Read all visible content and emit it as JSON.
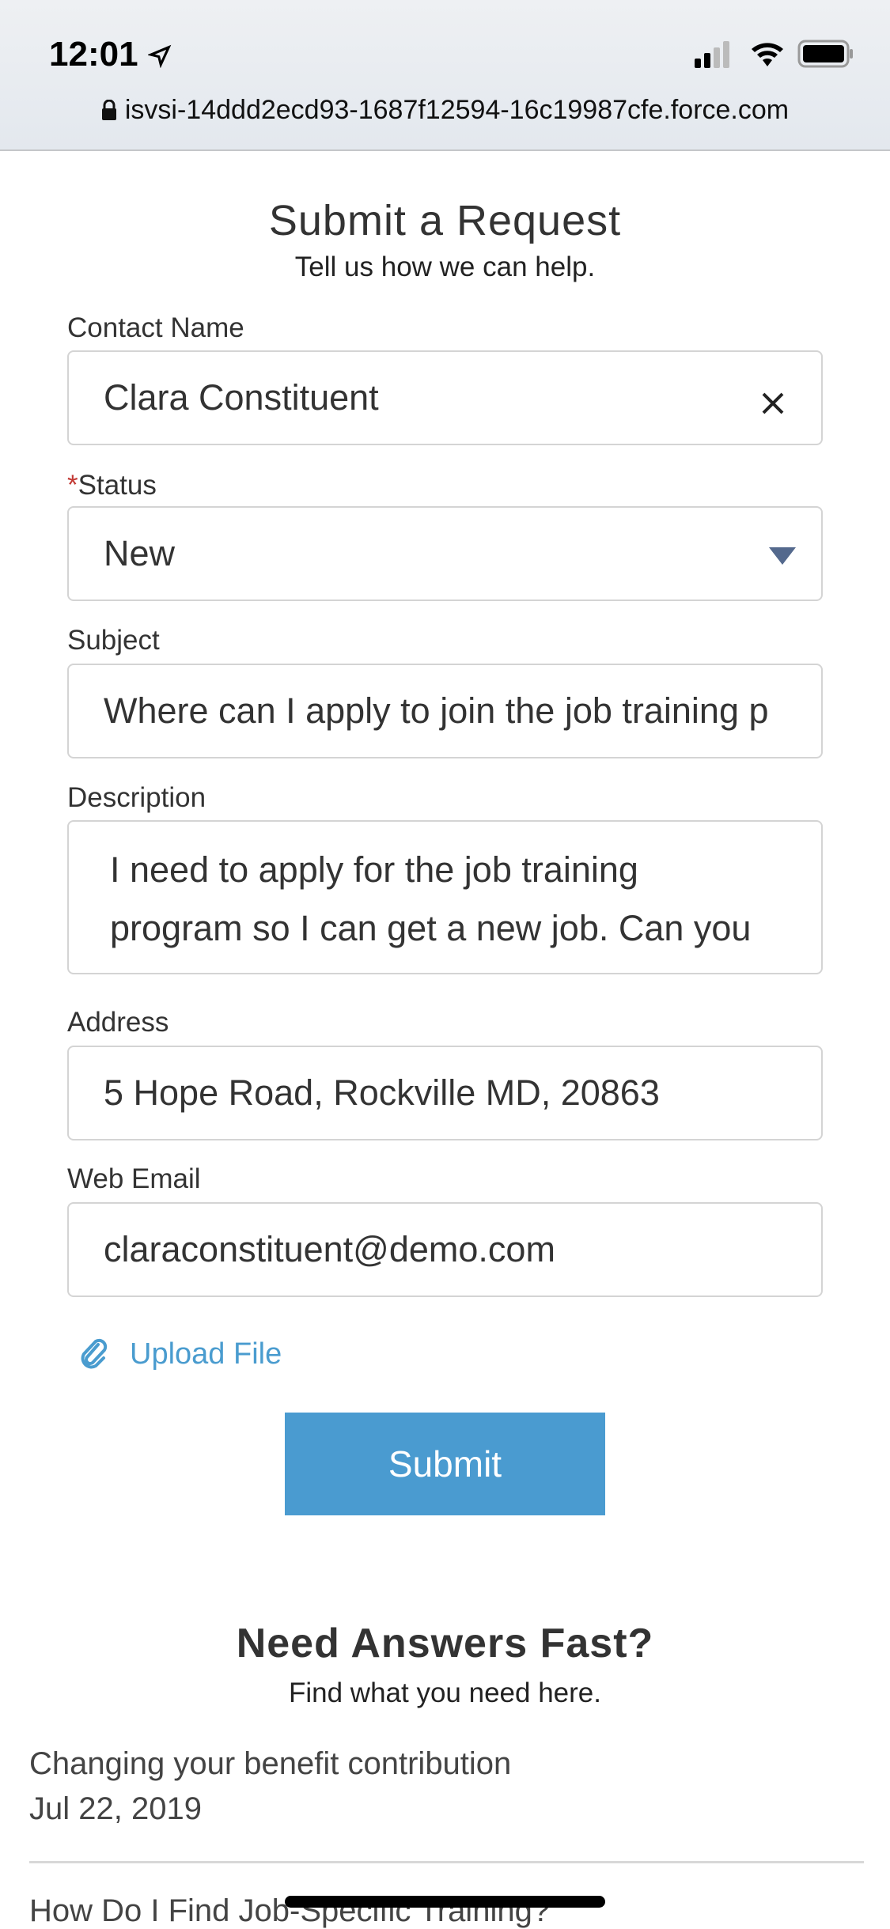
{
  "status_bar": {
    "time": "12:01",
    "icons": [
      "location-arrow-icon",
      "signal-icon",
      "wifi-icon",
      "battery-icon"
    ]
  },
  "browser": {
    "url": "isvsi-14ddd2ecd93-1687f12594-16c19987cfe.force.com"
  },
  "form": {
    "title": "Submit a Request",
    "subtitle": "Tell us how we can help.",
    "contact_name": {
      "label": "Contact Name",
      "value": "Clara Constituent"
    },
    "status": {
      "label": "Status",
      "required_mark": "*",
      "value": "New"
    },
    "subject": {
      "label": "Subject",
      "value": "Where can I apply to join the job training p"
    },
    "description": {
      "label": "Description",
      "value": "I need to apply for the job training program so I can get a new job. Can you"
    },
    "address": {
      "label": "Address",
      "value": "5 Hope Road, Rockville MD, 20863"
    },
    "web_email": {
      "label": "Web Email",
      "value": "claraconstituent@demo.com"
    },
    "upload_label": "Upload File",
    "submit_label": "Submit"
  },
  "answers": {
    "title": "Need Answers Fast?",
    "subtitle": "Find what you need here.",
    "articles": [
      {
        "title": "Changing your benefit contribution",
        "date": "Jul 22, 2019"
      },
      {
        "title": "How Do I Find Job-Specific Training?"
      }
    ]
  },
  "colors": {
    "accent": "#4a9bd0",
    "required": "#c23934"
  }
}
